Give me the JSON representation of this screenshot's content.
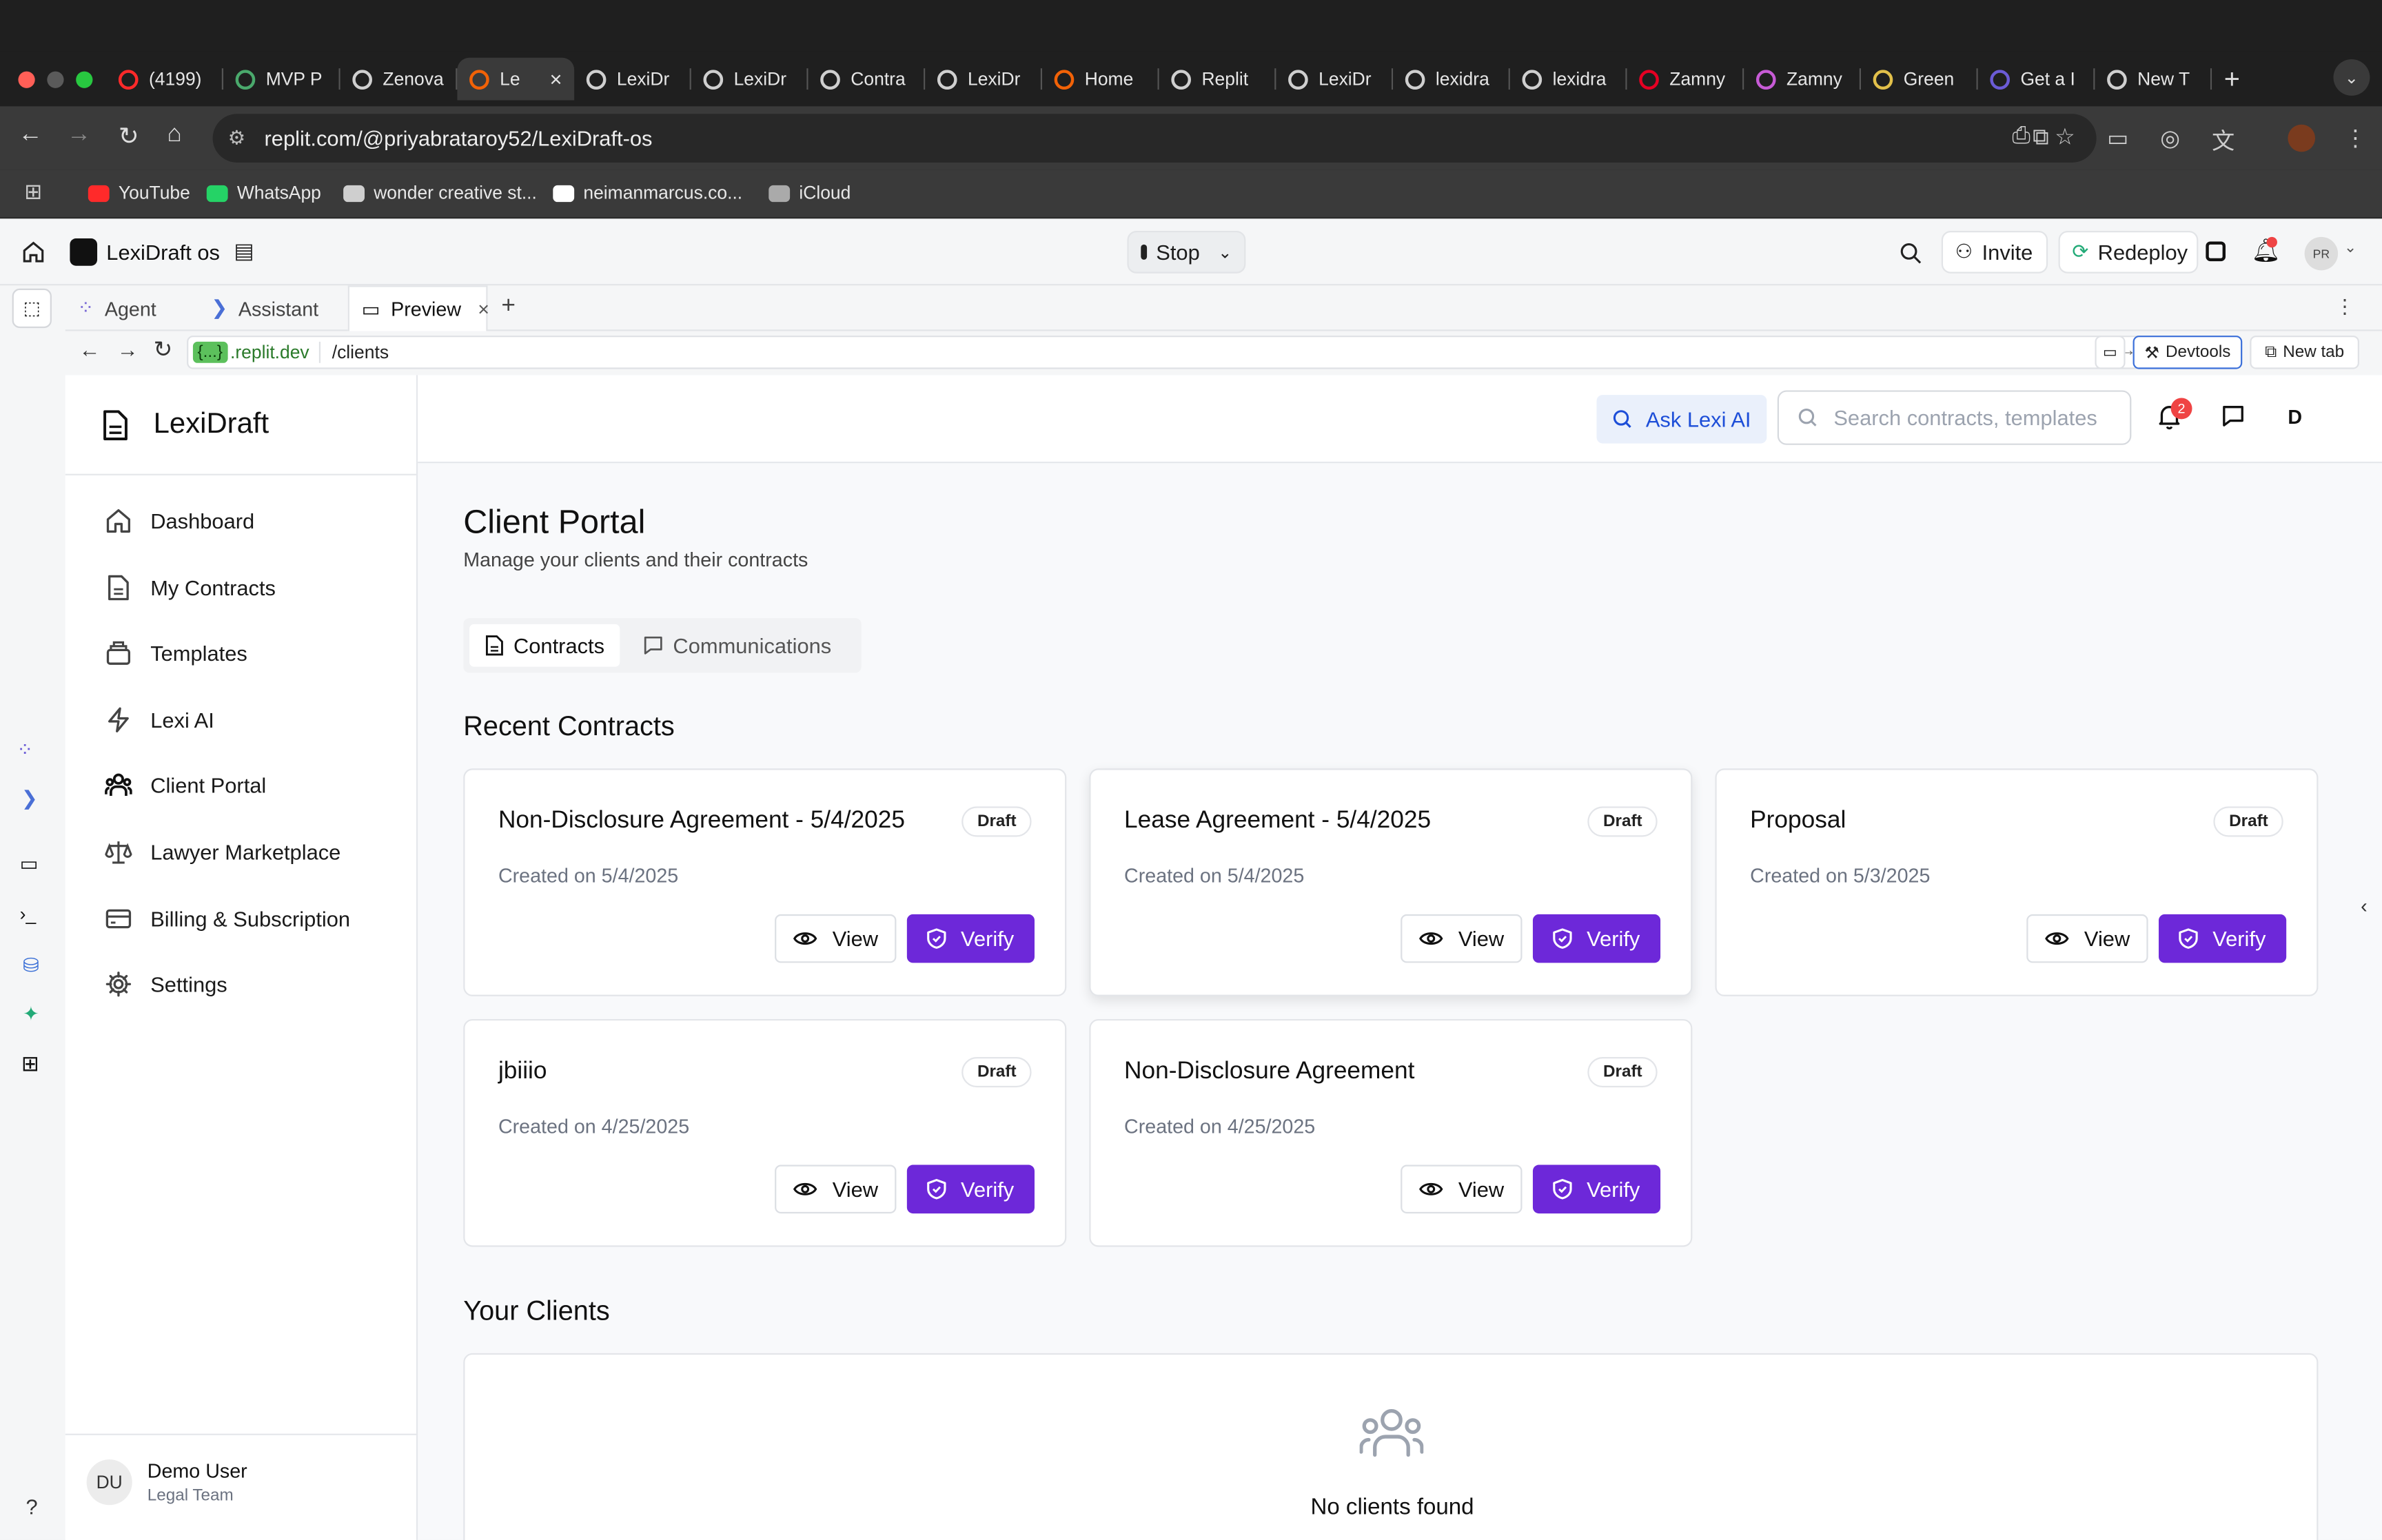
{
  "browser": {
    "tabs": [
      {
        "label": "(4199)",
        "color": "#ff2a2a"
      },
      {
        "label": "MVP P",
        "color": "#4aa96c"
      },
      {
        "label": "Zenova",
        "color": "#cfcfcf"
      },
      {
        "label": "Le",
        "color": "#f26207",
        "active": true
      },
      {
        "label": "LexiDr",
        "color": "#cfcfcf"
      },
      {
        "label": "LexiDr",
        "color": "#cfcfcf"
      },
      {
        "label": "Contra",
        "color": "#cfcfcf"
      },
      {
        "label": "LexiDr",
        "color": "#cfcfcf"
      },
      {
        "label": "Home",
        "color": "#f26207"
      },
      {
        "label": "Replit",
        "color": "#cfcfcf"
      },
      {
        "label": "LexiDr",
        "color": "#cfcfcf"
      },
      {
        "label": "lexidra",
        "color": "#cfcfcf"
      },
      {
        "label": "lexidra",
        "color": "#cfcfcf"
      },
      {
        "label": "Zamny",
        "color": "#e60023"
      },
      {
        "label": "Zamny",
        "color": "#c75bd6"
      },
      {
        "label": "Green",
        "color": "#e2c04a"
      },
      {
        "label": "Get a I",
        "color": "#6b5bd6"
      },
      {
        "label": "New T",
        "color": "#cfcfcf"
      }
    ],
    "url": "replit.com/@priyabrataroy52/LexiDraft-os",
    "bookmarks": [
      {
        "label": "YouTube",
        "color": "#ff2a2a"
      },
      {
        "label": "WhatsApp",
        "color": "#25d366"
      },
      {
        "label": "wonder creative st...",
        "color": "#cfcfcf"
      },
      {
        "label": "neimanmarcus.co...",
        "color": "#ffffff"
      },
      {
        "label": "iCloud",
        "color": "#aaaaaa"
      }
    ]
  },
  "replit": {
    "project_name": "LexiDraft os",
    "stop_label": "Stop",
    "invite_label": "Invite",
    "redeploy_label": "Redeploy",
    "avatar_initials": "PR",
    "tabs": {
      "agent": "Agent",
      "assistant": "Assistant",
      "preview": "Preview"
    },
    "preview_domain": ".replit.dev",
    "preview_domain_chip": "{...}",
    "preview_path": "/clients",
    "devtools_label": "Devtools",
    "newtab_label": "New tab"
  },
  "app": {
    "brand": "LexiDraft",
    "nav": [
      {
        "label": "Dashboard",
        "icon": "home-icon"
      },
      {
        "label": "My Contracts",
        "icon": "document-icon"
      },
      {
        "label": "Templates",
        "icon": "layers-icon"
      },
      {
        "label": "Lexi AI",
        "icon": "lightning-icon"
      },
      {
        "label": "Client Portal",
        "icon": "users-icon",
        "active": true
      },
      {
        "label": "Lawyer Marketplace",
        "icon": "scale-icon"
      },
      {
        "label": "Billing & Subscription",
        "icon": "credit-card-icon"
      },
      {
        "label": "Settings",
        "icon": "gear-icon"
      }
    ],
    "user": {
      "initials": "DU",
      "name": "Demo User",
      "team": "Legal Team"
    },
    "header": {
      "ask_label": "Ask Lexi AI",
      "search_placeholder": "Search contracts, templates",
      "notification_count": "2",
      "user_initial": "D"
    },
    "page": {
      "title": "Client Portal",
      "subtitle": "Manage your clients and their contracts",
      "tabs": {
        "contracts": "Contracts",
        "communications": "Communications"
      },
      "recent_title": "Recent Contracts",
      "contracts": [
        {
          "title": "Non-Disclosure Agreement - 5/4/2025",
          "status": "Draft",
          "created": "Created on 5/4/2025"
        },
        {
          "title": "Lease Agreement - 5/4/2025",
          "status": "Draft",
          "created": "Created on 5/4/2025"
        },
        {
          "title": "Proposal",
          "status": "Draft",
          "created": "Created on 5/3/2025"
        },
        {
          "title": "jbiiio",
          "status": "Draft",
          "created": "Created on 4/25/2025"
        },
        {
          "title": "Non-Disclosure Agreement",
          "status": "Draft",
          "created": "Created on 4/25/2025"
        }
      ],
      "view_label": "View",
      "verify_label": "Verify",
      "clients_title": "Your Clients",
      "no_clients": "No clients found"
    },
    "accent_color": "#6d28d9"
  }
}
